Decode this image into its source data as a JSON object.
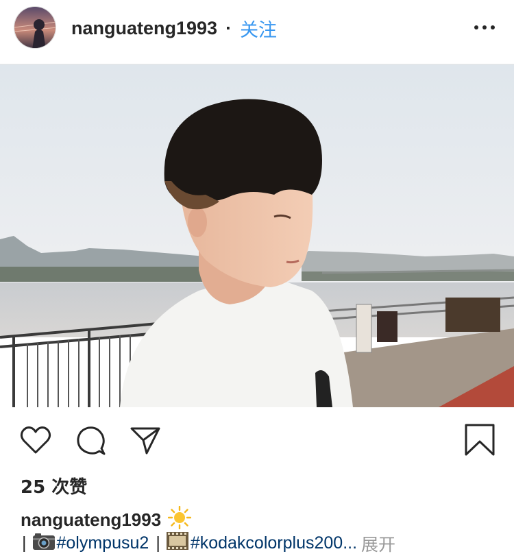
{
  "header": {
    "username": "nanguateng1993",
    "separator": "·",
    "follow_label": "关注",
    "more_icon": "more-horizontal-icon"
  },
  "post": {
    "image_description_icon": "photo"
  },
  "actions": {
    "like_icon": "heart-icon",
    "comment_icon": "comment-icon",
    "share_icon": "send-icon",
    "save_icon": "bookmark-icon"
  },
  "likes": {
    "text": "25 次赞"
  },
  "caption": {
    "username": "nanguateng1993",
    "sun_emoji_icon": "sun-icon",
    "bar1": "|",
    "camera_icon": "camera-icon",
    "hashtag1": "#olympusu2",
    "bar2": "|",
    "film_icon": "film-icon",
    "hashtag2": "#kodakcolorplus200...",
    "more_label": "展开"
  },
  "colors": {
    "link_blue": "#3897f0",
    "hashtag_blue": "#003569",
    "text": "#262626",
    "muted": "#999999"
  }
}
